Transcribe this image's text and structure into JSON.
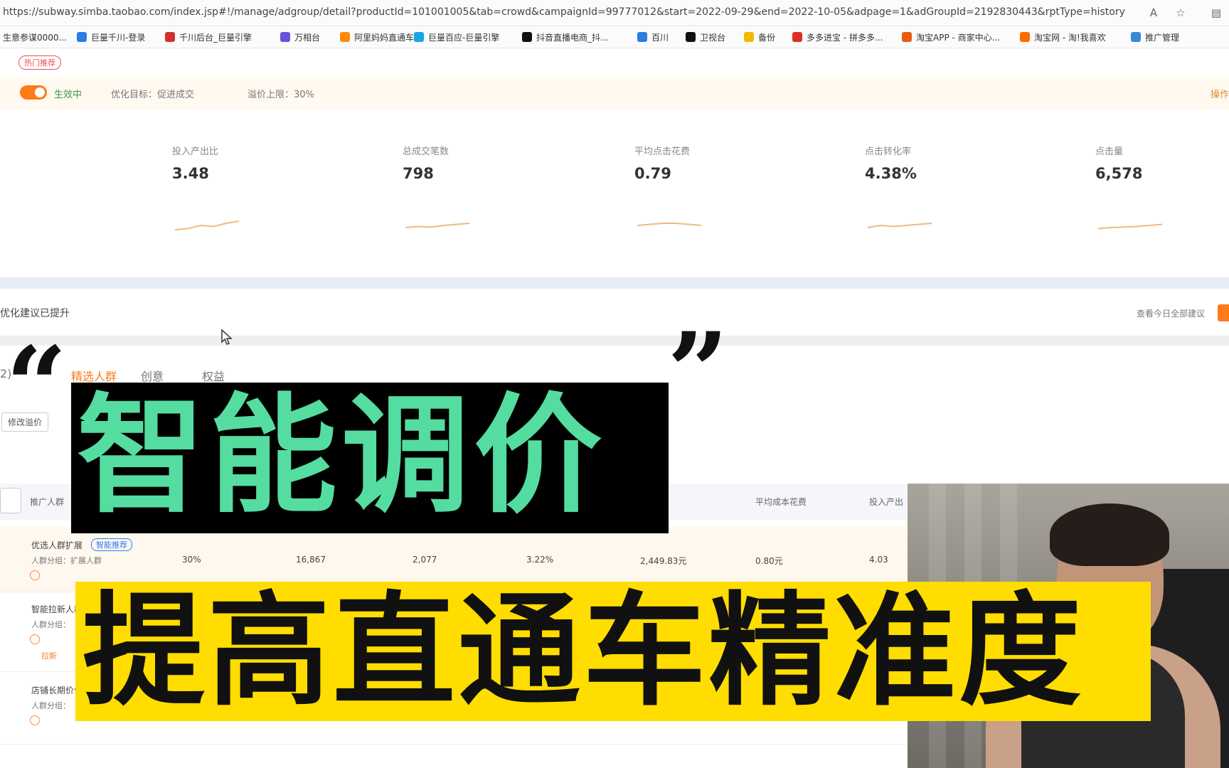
{
  "browser": {
    "url": "https://subway.simba.taobao.com/index.jsp#!/manage/adgroup/detail?productId=101001005&tab=crowd&campaignId=99777012&start=2022-09-29&end=2022-10-05&adpage=1&adGroupId=2192830443&rptType=history",
    "bookmarks": [
      {
        "label": "生意参谋0000...",
        "color": "#1b6fd8"
      },
      {
        "label": "巨量千川-登录",
        "color": "#2a7de1"
      },
      {
        "label": "千川后台_巨量引擎",
        "color": "#d03030"
      },
      {
        "label": "万相台",
        "color": "#6a4fe0"
      },
      {
        "label": "阿里妈妈直通车",
        "color": "#ff8a00"
      },
      {
        "label": "巨量百应-巨量引擎",
        "color": "#19a5e6"
      },
      {
        "label": "抖音直播电商_抖...",
        "color": "#111111"
      },
      {
        "label": "百川",
        "color": "#2a7de1"
      },
      {
        "label": "卫视台",
        "color": "#111111"
      },
      {
        "label": "备份",
        "color": "#f5b800"
      },
      {
        "label": "多多进宝 - 拼多多...",
        "color": "#e02e24"
      },
      {
        "label": "淘宝APP - 商家中心...",
        "color": "#e85b10"
      },
      {
        "label": "淘宝网 - 淘!我喜欢",
        "color": "#ff6a00"
      },
      {
        "label": "推广管理",
        "color": "#3b8ad8"
      }
    ]
  },
  "page": {
    "pill": "热门推荐",
    "status": {
      "toggle_label": "生效中",
      "optimize_target": "优化目标：促进成交",
      "premium": "溢价上限：30%",
      "right_link": "操作"
    },
    "metrics": [
      {
        "label": "投入产出比",
        "value": "3.48",
        "trend": [
          0.3,
          0.35,
          0.5,
          0.45,
          0.6,
          0.7
        ]
      },
      {
        "label": "总成交笔数",
        "value": "798",
        "trend": [
          0.4,
          0.45,
          0.42,
          0.5,
          0.55,
          0.6
        ]
      },
      {
        "label": "平均点击花费",
        "value": "0.79",
        "trend": [
          0.5,
          0.55,
          0.6,
          0.6,
          0.55,
          0.5
        ]
      },
      {
        "label": "点击转化率",
        "value": "4.38%",
        "trend": [
          0.4,
          0.5,
          0.45,
          0.5,
          0.55,
          0.6
        ]
      },
      {
        "label": "点击量",
        "value": "6,578",
        "trend": [
          0.35,
          0.4,
          0.42,
          0.45,
          0.5,
          0.55
        ]
      }
    ],
    "section_label": "优化建议已提升",
    "section_right": "查看今日全部建议",
    "tabs": {
      "count": "2)",
      "crowd": "精选人群",
      "creative": "创意",
      "rights": "权益"
    },
    "modify_button": "修改溢价",
    "table_headers": {
      "crowd": "推广人群",
      "avg_cost": "平均成本花费",
      "roi": "投入产出"
    },
    "rows": [
      {
        "name": "优选人群扩展",
        "tag": "智能推荐",
        "sub": "人群分组：扩展人群",
        "premium": "30%",
        "impressions": "16,867",
        "clicks": "2,077",
        "ctr": "3.22%",
        "cost": "2,449.83元",
        "avg": "0.80元",
        "roi": "4.03"
      },
      {
        "name": "智能拉新人群",
        "sub": "人群分组：",
        "tag2": "拉新"
      },
      {
        "name": "店铺长期价值人群",
        "sub": "人群分组："
      }
    ]
  },
  "overlay": {
    "quote_open": "“",
    "quote_close": "”",
    "title_line1": "智能调价",
    "title_line2": "提高直通车精准度"
  },
  "colors": {
    "accent": "#ff7a1a",
    "title_green": "#55dca0",
    "title_yellow": "#ffdd00",
    "title_black": "#000000"
  }
}
